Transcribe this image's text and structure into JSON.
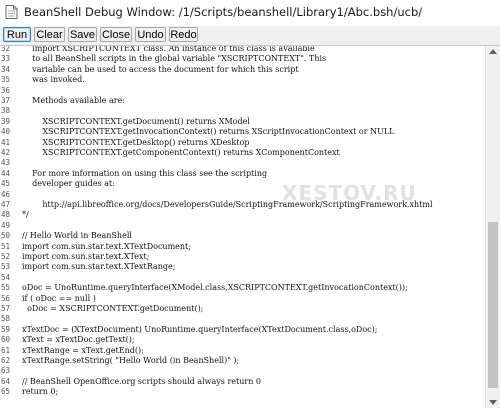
{
  "window": {
    "title": "BeanShell Debug Window: /1/Scripts/beanshell/Library1/Abc.bsh/ucb/",
    "icon": "document-icon"
  },
  "toolbar": {
    "buttons": [
      "Run",
      "Clear",
      "Save",
      "Close",
      "Undo",
      "Redo"
    ]
  },
  "editor": {
    "lines": [
      {
        "n": "32",
        "text": "    import XSCRIPTCONTEXT class. An instance of this class is available"
      },
      {
        "n": "33",
        "text": "    to all BeanShell scripts in the global variable \"XSCRIPTCONTEXT\". This"
      },
      {
        "n": "34",
        "text": "    variable can be used to access the document for which this script"
      },
      {
        "n": "35",
        "text": "    was invoked."
      },
      {
        "n": "36",
        "text": ""
      },
      {
        "n": "37",
        "text": "    Methods available are:"
      },
      {
        "n": "38",
        "text": ""
      },
      {
        "n": "39",
        "text": "        XSCRIPTCONTEXT.getDocument() returns XModel"
      },
      {
        "n": "40",
        "text": "        XSCRIPTCONTEXT.getInvocationContext() returns XScriptInvocationContext or NULL"
      },
      {
        "n": "41",
        "text": "        XSCRIPTCONTEXT.getDesktop() returns XDesktop"
      },
      {
        "n": "42",
        "text": "        XSCRIPTCONTEXT.getComponentContext() returns XComponentContext"
      },
      {
        "n": "43",
        "text": ""
      },
      {
        "n": "44",
        "text": "    For more information on using this class see the scripting"
      },
      {
        "n": "45",
        "text": "    developer guides at:"
      },
      {
        "n": "46",
        "text": ""
      },
      {
        "n": "47",
        "text": "        http://api.libreoffice.org/docs/DevelopersGuide/ScriptingFramework/ScriptingFramework.xhtml"
      },
      {
        "n": "48",
        "text": "*/"
      },
      {
        "n": "49",
        "text": ""
      },
      {
        "n": "50",
        "text": "// Hello World in BeanShell"
      },
      {
        "n": "51",
        "text": "import com.sun.star.text.XTextDocument;"
      },
      {
        "n": "52",
        "text": "import com.sun.star.text.XText;"
      },
      {
        "n": "53",
        "text": "import com.sun.star.text.XTextRange;"
      },
      {
        "n": "54",
        "text": ""
      },
      {
        "n": "55",
        "text": "oDoc = UnoRuntime.queryInterface(XModel.class,XSCRIPTCONTEXT.getInvocationContext());"
      },
      {
        "n": "56",
        "text": "if ( oDoc == null )"
      },
      {
        "n": "57",
        "text": "  oDoc = XSCRIPTCONTEXT.getDocument();"
      },
      {
        "n": "58",
        "text": ""
      },
      {
        "n": "59",
        "text": "xTextDoc = (XTextDocument) UnoRuntime.queryInterface(XTextDocument.class,oDoc);"
      },
      {
        "n": "60",
        "text": "xText = xTextDoc.getText();"
      },
      {
        "n": "61",
        "text": "xTextRange = xText.getEnd();"
      },
      {
        "n": "62",
        "text": "xTextRange.setString( \"Hello World (in BeanShell)\" );"
      },
      {
        "n": "63",
        "text": ""
      },
      {
        "n": "64",
        "text": "// BeanShell OpenOffice.org scripts should always return 0"
      },
      {
        "n": "65",
        "text": "return 0;"
      }
    ]
  },
  "watermark": {
    "text": "XESTOV.RU"
  },
  "colors": {
    "toolbar_bg": "#f0f0f0",
    "focus_border": "#3c7fb1",
    "text": "#111111"
  }
}
